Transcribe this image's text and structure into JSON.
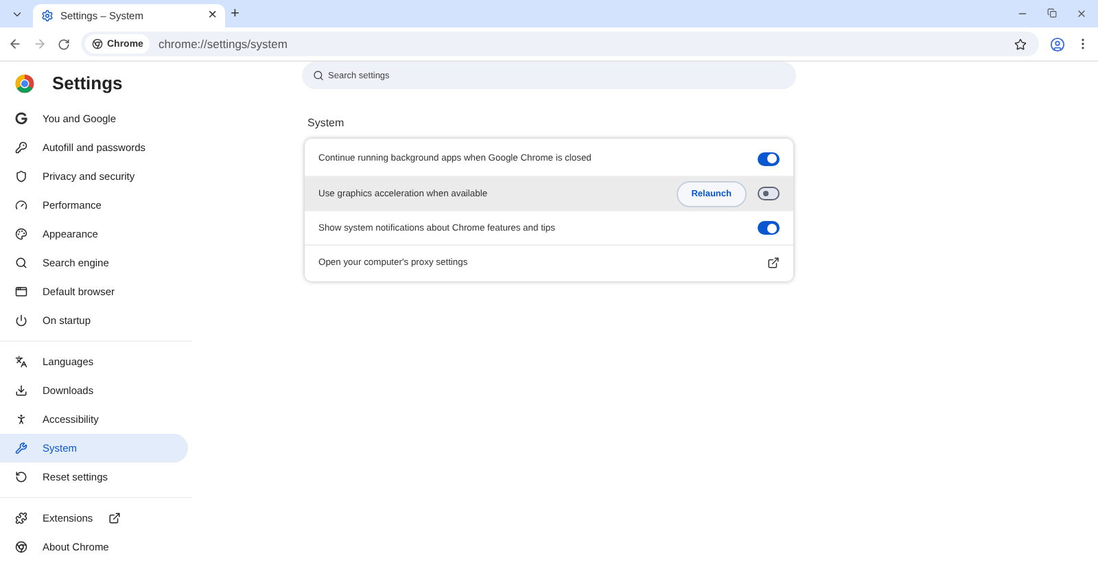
{
  "tab": {
    "title": "Settings – System",
    "close": "×"
  },
  "new_tab": "+",
  "address": {
    "chip": "Chrome",
    "url": "chrome://settings/system"
  },
  "header": {
    "title": "Settings"
  },
  "search": {
    "placeholder": "Search settings"
  },
  "sidebar": {
    "groups": [
      {
        "items": [
          {
            "label": "You and Google",
            "selected": false
          },
          {
            "label": "Autofill and passwords",
            "selected": false
          },
          {
            "label": "Privacy and security",
            "selected": false
          },
          {
            "label": "Performance",
            "selected": false
          },
          {
            "label": "Appearance",
            "selected": false
          },
          {
            "label": "Search engine",
            "selected": false
          },
          {
            "label": "Default browser",
            "selected": false
          },
          {
            "label": "On startup",
            "selected": false
          }
        ]
      },
      {
        "items": [
          {
            "label": "Languages",
            "selected": false
          },
          {
            "label": "Downloads",
            "selected": false
          },
          {
            "label": "Accessibility",
            "selected": false
          },
          {
            "label": "System",
            "selected": true
          },
          {
            "label": "Reset settings",
            "selected": false
          }
        ]
      },
      {
        "items": [
          {
            "label": "Extensions",
            "selected": false,
            "external": true
          },
          {
            "label": "About Chrome",
            "selected": false,
            "external": false
          }
        ]
      }
    ]
  },
  "section": {
    "title": "System",
    "rows": [
      {
        "kind": "toggle",
        "label": "Continue running background apps when Google Chrome is closed",
        "on": true,
        "highlighted": false
      },
      {
        "kind": "toggle",
        "label": "Use graphics acceleration when available",
        "on": false,
        "highlighted": true,
        "button": "Relaunch"
      },
      {
        "kind": "toggle",
        "label": "Show system notifications about Chrome features and tips",
        "on": true,
        "highlighted": false
      },
      {
        "kind": "link",
        "label": "Open your computer's proxy settings",
        "highlighted": false
      }
    ]
  }
}
